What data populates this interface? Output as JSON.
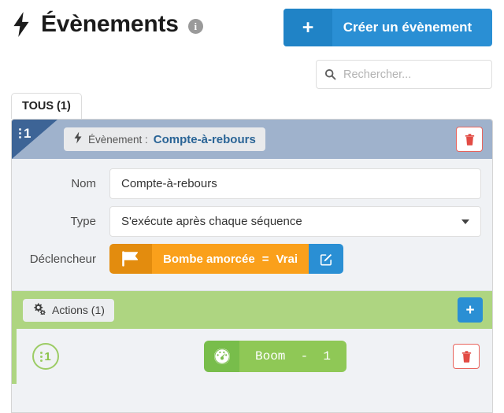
{
  "header": {
    "title": "Évènements",
    "bolt_icon": "bolt-icon",
    "info_icon": "info-icon",
    "info_glyph": "i",
    "create_button": {
      "plus": "+",
      "label": "Créer un évènement"
    },
    "search": {
      "placeholder": "Rechercher...",
      "value": "",
      "icon": "search-icon"
    }
  },
  "tabs": [
    {
      "label": "TOUS (1)",
      "active": true
    }
  ],
  "event": {
    "index": "1",
    "chip_label": "Évènement :",
    "chip_value": "Compte-à-rebours",
    "delete_icon": "trash-icon",
    "fields": [
      {
        "label": "Nom",
        "value": "Compte-à-rebours",
        "type": "text"
      },
      {
        "label": "Type",
        "value": "S'exécute après chaque séquence",
        "type": "select"
      }
    ],
    "trigger": {
      "label": "Déclencheur",
      "flag_icon": "flag-icon",
      "variable": "Bombe amorcée",
      "operator": "=",
      "comparison": "Vrai",
      "edit_icon": "edit-icon"
    },
    "actions": {
      "icon": "cogs-icon",
      "label": "Actions (1)",
      "add_button": "+",
      "rows": [
        {
          "index": "1",
          "icon": "gauge-icon",
          "text": "Boom  -  1",
          "delete_icon": "trash-icon"
        }
      ]
    }
  },
  "colors": {
    "accent_blue": "#2a8fd4",
    "event_header": "#9fb2cc",
    "corner_dark": "#3d6496",
    "actions_green": "#aed581",
    "action_pill_green": "#8fc856",
    "trigger_orange": "#faa01b",
    "danger_red": "#e24b44"
  }
}
